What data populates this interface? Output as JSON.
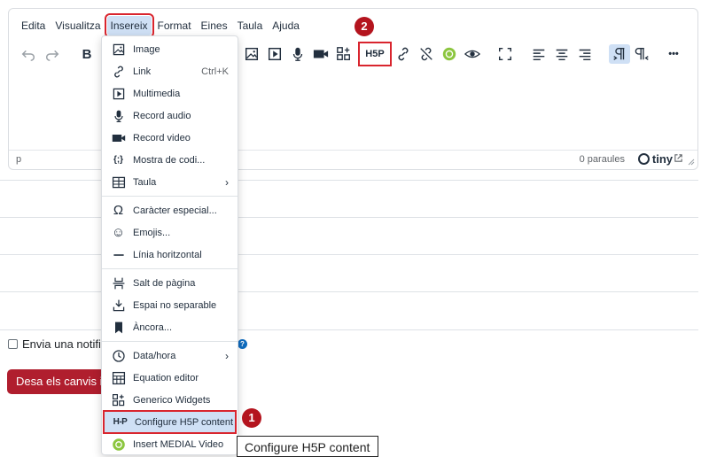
{
  "menubar": {
    "items": [
      "Edita",
      "Visualitza",
      "Insereix",
      "Format",
      "Eines",
      "Taula",
      "Ajuda"
    ],
    "active": "Insereix"
  },
  "toolbar": {
    "icons": [
      "undo-icon",
      "redo-icon",
      "bold-icon",
      "image-icon",
      "media-icon",
      "microphone-icon",
      "video-camera-icon",
      "widgets-icon",
      "h5p-icon",
      "link-icon",
      "unlink-icon",
      "medial-icon",
      "preview-icon",
      "fullscreen-icon",
      "align-left-icon",
      "align-center-icon",
      "align-right-icon",
      "ltr-icon",
      "rtl-icon",
      "more-icon"
    ],
    "h5p_label": "H5P",
    "bold_label": "B",
    "more_label": "•••"
  },
  "statusbar": {
    "path": "p",
    "word_count": "0 paraules",
    "brand": "tiny"
  },
  "insert_menu": {
    "items": [
      {
        "label": "Image",
        "icon": "image-icon"
      },
      {
        "label": "Link",
        "icon": "link-icon",
        "shortcut": "Ctrl+K"
      },
      {
        "label": "Multimedia",
        "icon": "media-icon"
      },
      {
        "label": "Record audio",
        "icon": "microphone-icon"
      },
      {
        "label": "Record video",
        "icon": "video-camera-icon"
      },
      {
        "label": "Mostra de codi...",
        "icon": "code-sample-icon"
      },
      {
        "label": "Taula",
        "icon": "table-icon",
        "submenu": true
      },
      {
        "label": "Caràcter especial...",
        "icon": "omega-icon"
      },
      {
        "label": "Emojis...",
        "icon": "emoji-icon"
      },
      {
        "label": "Línia horitzontal",
        "icon": "horizontal-line-icon"
      },
      {
        "label": "Salt de pàgina",
        "icon": "page-break-icon"
      },
      {
        "label": "Espai no separable",
        "icon": "nbsp-icon"
      },
      {
        "label": "Àncora...",
        "icon": "bookmark-icon"
      },
      {
        "label": "Data/hora",
        "icon": "clock-icon",
        "submenu": true
      },
      {
        "label": "Equation editor",
        "icon": "calculator-icon"
      },
      {
        "label": "Generico Widgets",
        "icon": "widgets-icon"
      },
      {
        "label": "Configure H5P content",
        "icon": "h5p-icon"
      },
      {
        "label": "Insert MEDIAL Video",
        "icon": "medial-icon"
      }
    ],
    "code_glyph": "{;}",
    "omega_glyph": "Ω",
    "emoji_glyph": "☺",
    "submenu_arrow": "›",
    "h5p_mini": "H-P"
  },
  "form": {
    "notify_label": "Envia una notific",
    "help_glyph": "?",
    "save_button": "Desa els canvis i t"
  },
  "annotations": {
    "badge_1": "1",
    "badge_2": "2",
    "tooltip": "Configure H5P content"
  },
  "colors": {
    "accent_red": "#d9252e",
    "highlight_blue": "#cfe0f5",
    "save_button_bg": "#b01e2e",
    "medial_green": "#8cc63f"
  }
}
